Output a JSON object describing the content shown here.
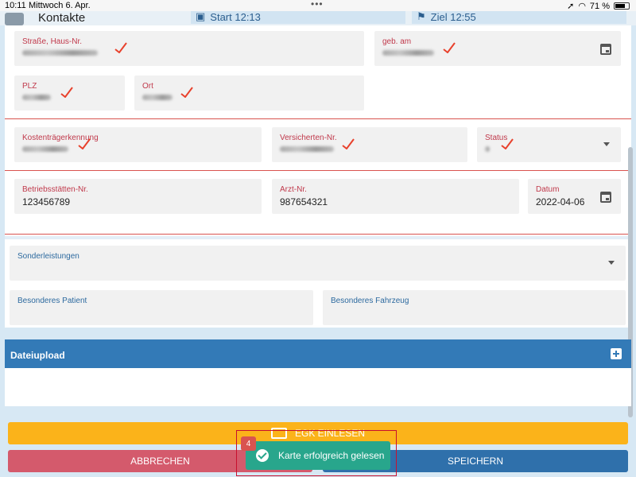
{
  "status_bar": {
    "time": "10:11",
    "date": "Mittwoch 6. Apr.",
    "battery": "71 %"
  },
  "header": {
    "title": "Kontakte",
    "tab_start": "Start 12:13",
    "tab_ziel": "Ziel 12:55"
  },
  "form": {
    "strasse_label": "Straße, Haus-Nr.",
    "geb_label": "geb. am",
    "plz_label": "PLZ",
    "ort_label": "Ort",
    "kostentraeger_label": "Kostenträgerkennung",
    "versicherten_label": "Versicherten-Nr.",
    "status_label": "Status",
    "betriebsstaetten_label": "Betriebsstätten-Nr.",
    "betriebsstaetten_value": "123456789",
    "arzt_label": "Arzt-Nr.",
    "arzt_value": "987654321",
    "datum_label": "Datum",
    "datum_value": "2022-04-06",
    "sonderleistungen_label": "Sonderleistungen",
    "besonderes_patient_label": "Besonderes Patient",
    "besonderes_fahrzeug_label": "Besonderes Fahrzeug"
  },
  "upload": {
    "title": "Dateiupload"
  },
  "buttons": {
    "egk": "EGK EINLESEN",
    "abbrechen": "ABBRECHEN",
    "speichern": "SPEICHERN"
  },
  "toast": {
    "badge": "4",
    "message": "Karte erfolgreich gelesen"
  },
  "colors": {
    "accent": "#337ab7",
    "danger": "#d45a6c",
    "warning": "#fbb31a",
    "success": "#28a68c"
  }
}
